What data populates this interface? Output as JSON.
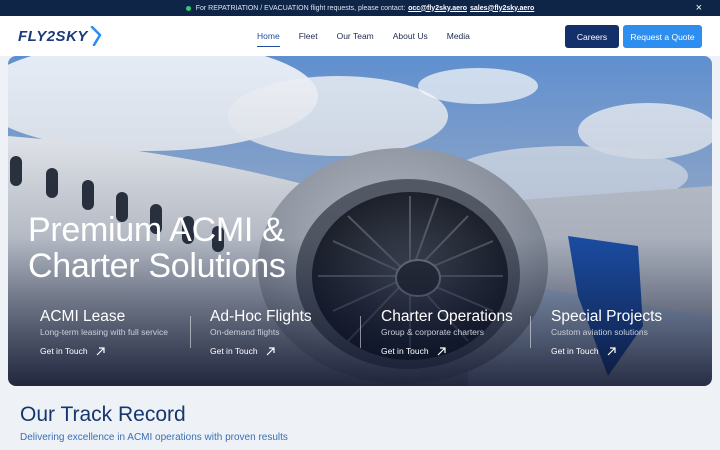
{
  "topbar": {
    "message": "For REPATRIATION / EVACUATION flight requests, please contact:",
    "email_ops": "occ@fly2sky.aero",
    "email_sales": "sales@fly2sky.aero",
    "close_label": "×"
  },
  "header": {
    "logo_text": "FLY2SKY",
    "nav": [
      {
        "label": "Home",
        "active": true
      },
      {
        "label": "Fleet"
      },
      {
        "label": "Our Team"
      },
      {
        "label": "About Us"
      },
      {
        "label": "Media"
      }
    ],
    "careers_label": "Careers",
    "quote_label": "Request a Quote"
  },
  "hero": {
    "title_line1": "Premium ACMI &",
    "title_line2": "Charter Solutions",
    "services": [
      {
        "title": "ACMI Lease",
        "subtitle": "Long-term leasing with full service",
        "link": "Get in Touch"
      },
      {
        "title": "Ad-Hoc Flights",
        "subtitle": "On-demand flights",
        "link": "Get in Touch"
      },
      {
        "title": "Charter Operations",
        "subtitle": "Group & corporate charters",
        "link": "Get in Touch"
      },
      {
        "title": "Special Projects",
        "subtitle": "Custom aviation solutions",
        "link": "Get in Touch"
      }
    ]
  },
  "track": {
    "title": "Our Track Record",
    "subtitle": "Delivering excellence in ACMI operations with proven results"
  },
  "colors": {
    "navy": "#0f2547",
    "brand_blue": "#1b3a78",
    "accent": "#2d8ef0",
    "careers_bg": "#13306a"
  }
}
